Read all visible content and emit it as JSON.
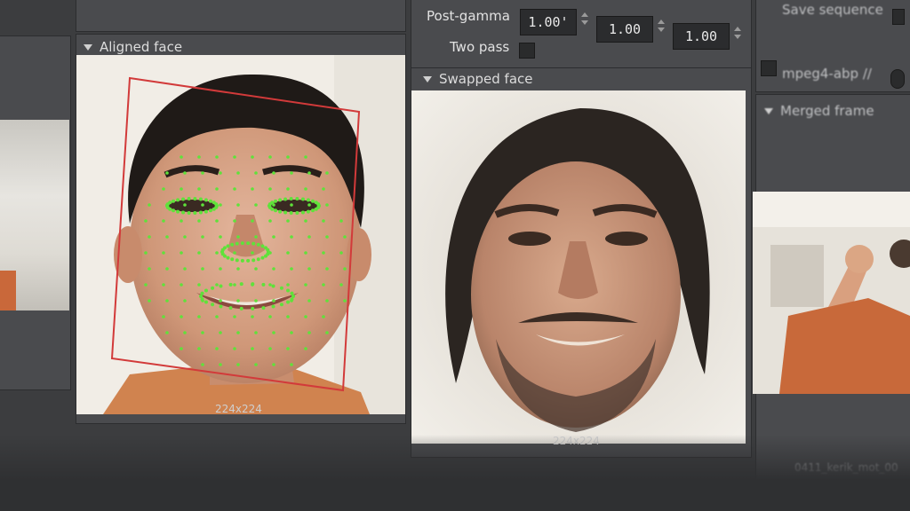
{
  "settings": {
    "post_gamma_label": "Post-gamma",
    "post_gamma_values": [
      "1.00'",
      "1.00",
      "1.00"
    ],
    "two_pass_label": "Two pass",
    "save_sequence_label": "Save sequence",
    "output_format": "mpeg4-abp //"
  },
  "panels": {
    "aligned": {
      "title": "Aligned face",
      "size": "224x224"
    },
    "swapped": {
      "title": "Swapped face",
      "size": "224x224"
    },
    "merged": {
      "title": "Merged frame",
      "filename": "0411_kerik_mot_00"
    }
  },
  "colors": {
    "landmarks": "#5fe23a",
    "bbox": "#d23a3a",
    "panel_bg": "#4a4b4e"
  }
}
